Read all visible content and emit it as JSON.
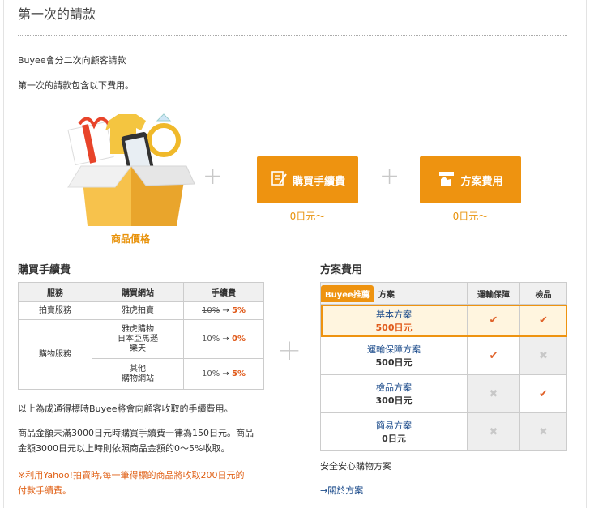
{
  "page": {
    "title": "第一次的請款",
    "intro1": "Buyee會分二次向顧客請款",
    "intro2": "第一次的請款包含以下費用。"
  },
  "items": {
    "goods_label": "商品價格",
    "fee_button": "購買手續費",
    "plan_button": "方案費用",
    "fee_price": "0日元〜",
    "plan_price": "0日元〜"
  },
  "fee_section": {
    "title": "購買手續費",
    "headers": [
      "服務",
      "購買網站",
      "手續費"
    ],
    "rows": [
      {
        "service": "拍賣服務",
        "site": "雅虎拍賣",
        "old": "10%",
        "arrow": "→",
        "new": "5%"
      },
      {
        "service": "購物服務",
        "site_lines": [
          "雅虎購物",
          "日本亞馬遜",
          "樂天"
        ],
        "old": "10%",
        "arrow": "→",
        "new": "0%"
      },
      {
        "site_lines": [
          "其他",
          "購物網站"
        ],
        "old": "10%",
        "arrow": "→",
        "new": "5%"
      }
    ],
    "note1": "以上為成通得標時Buyee將會向顧客收取的手續費用。",
    "note2a": "商品金額未滿3000日元時購買手續費一律為150日元。商品",
    "note2b": "金額3000日元以上時則依照商品金額的0〜5%收取。",
    "note3a": "※利用Yahoo!拍賣時,每一筆得標的商品將收取200日元的",
    "note3b": "付款手續費。"
  },
  "plan_section": {
    "title": "方案費用",
    "badge": "Buyee推薦",
    "headers": [
      "方案",
      "運輸保障",
      "檢品"
    ],
    "rows": [
      {
        "name": "基本方案",
        "price": "500日元",
        "shipping": "check",
        "inspect": "check"
      },
      {
        "name": "運輸保障方案",
        "price": "500日元",
        "shipping": "check",
        "inspect": "cross"
      },
      {
        "name": "檢品方案",
        "price": "300日元",
        "shipping": "cross",
        "inspect": "check"
      },
      {
        "name": "簡易方案",
        "price": "0日元",
        "shipping": "cross",
        "inspect": "cross"
      }
    ],
    "safety": "安全安心購物方案",
    "link": "→關於方案"
  },
  "glyphs": {
    "check": "✔",
    "cross": "✖",
    "plus": "+"
  },
  "colors": {
    "accent": "#ee9310",
    "red": "#e05a1a",
    "link": "#1a4a8a"
  }
}
